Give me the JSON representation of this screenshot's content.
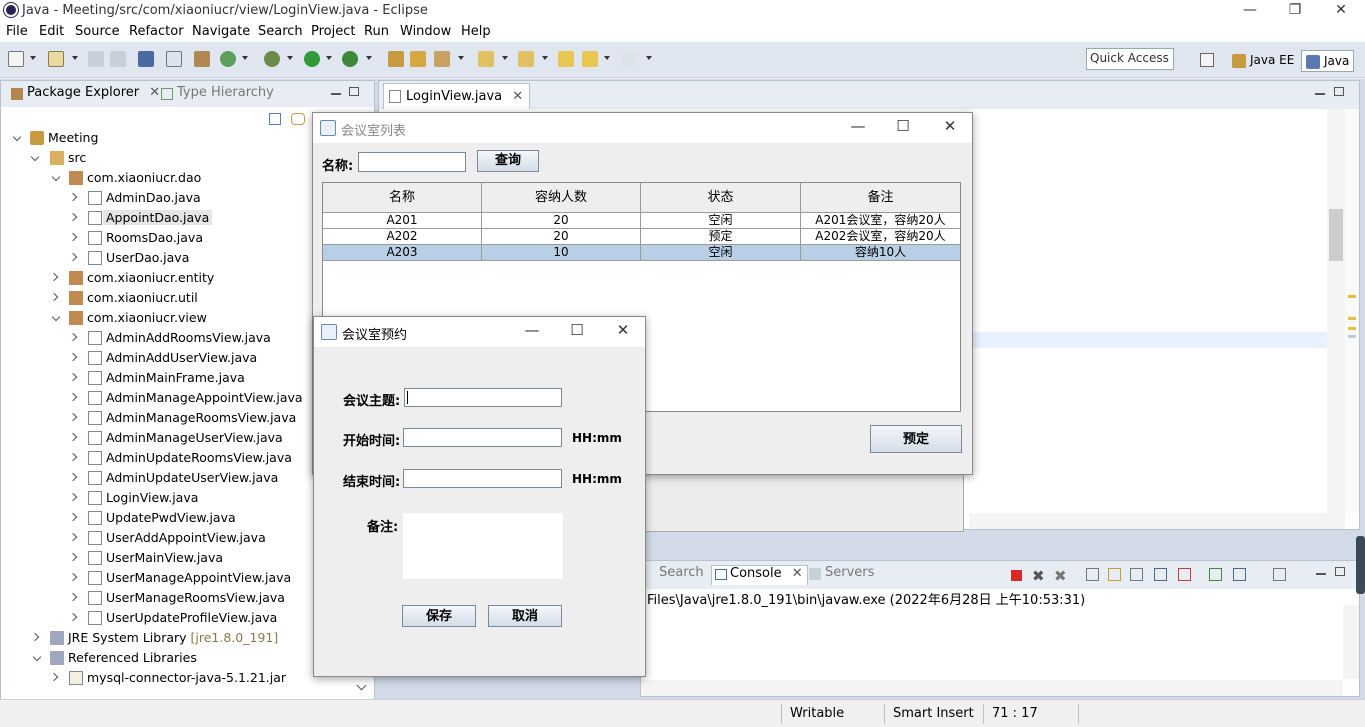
{
  "window": {
    "title": "Java - Meeting/src/com/xiaoniucr/view/LoginView.java - Eclipse"
  },
  "menu": [
    "File",
    "Edit",
    "Source",
    "Refactor",
    "Navigate",
    "Search",
    "Project",
    "Run",
    "Window",
    "Help"
  ],
  "toolbar": {
    "quick_access": "Quick Access",
    "perspective_javaee": "Java EE",
    "perspective_java": "Java"
  },
  "package_explorer": {
    "tab_label": "Package Explorer",
    "tab2_label": "Type Hierarchy",
    "tree": [
      {
        "label": "Meeting"
      },
      {
        "label": "src"
      },
      {
        "label": "com.xiaoniucr.dao"
      },
      {
        "label": "AdminDao.java"
      },
      {
        "label": "AppointDao.java"
      },
      {
        "label": "RoomsDao.java"
      },
      {
        "label": "UserDao.java"
      },
      {
        "label": "com.xiaoniucr.entity"
      },
      {
        "label": "com.xiaoniucr.util"
      },
      {
        "label": "com.xiaoniucr.view"
      },
      {
        "label": "AdminAddRoomsView.java"
      },
      {
        "label": "AdminAddUserView.java"
      },
      {
        "label": "AdminMainFrame.java"
      },
      {
        "label": "AdminManageAppointView.java"
      },
      {
        "label": "AdminManageRoomsView.java"
      },
      {
        "label": "AdminManageUserView.java"
      },
      {
        "label": "AdminUpdateRoomsView.java"
      },
      {
        "label": "AdminUpdateUserView.java"
      },
      {
        "label": "LoginView.java"
      },
      {
        "label": "UpdatePwdView.java"
      },
      {
        "label": "UserAddAppointView.java"
      },
      {
        "label": "UserMainView.java"
      },
      {
        "label": "UserManageAppointView.java"
      },
      {
        "label": "UserManageRoomsView.java"
      },
      {
        "label": "UserUpdateProfileView.java"
      },
      {
        "label": "JRE System Library",
        "extra": "[jre1.8.0_191]"
      },
      {
        "label": "Referenced Libraries"
      },
      {
        "label": "mysql-connector-java-5.1.21.jar"
      }
    ]
  },
  "editor": {
    "tab_label": "LoginView.java"
  },
  "console": {
    "tabs": [
      "Search",
      "Console",
      "Servers"
    ],
    "output": "Files\\Java\\jre1.8.0_191\\bin\\javaw.exe (2022年6月28日 上午10:53:31)"
  },
  "status": {
    "writable": "Writable",
    "insert_mode": "Smart Insert",
    "position": "71 : 17"
  },
  "room_list": {
    "title": "会议室列表",
    "name_label": "名称:",
    "search_button": "查询",
    "book_button": "预定",
    "columns": [
      "名称",
      "容纳人数",
      "状态",
      "备注"
    ],
    "rows": [
      {
        "name": "A201",
        "capacity": "20",
        "status": "空闲",
        "note": "A201会议室，容纳20人"
      },
      {
        "name": "A202",
        "capacity": "20",
        "status": "预定",
        "note": "A202会议室，容纳20人"
      },
      {
        "name": "A203",
        "capacity": "10",
        "status": "空闲",
        "note": "容纳10人"
      }
    ]
  },
  "booking": {
    "title": "会议室预约",
    "subject_label": "会议主题:",
    "start_label": "开始时间:",
    "end_label": "结束时间:",
    "note_label": "备注:",
    "time_hint_start": "HH:mm",
    "time_hint_end": "HH:mm",
    "save_button": "保存",
    "cancel_button": "取消"
  }
}
